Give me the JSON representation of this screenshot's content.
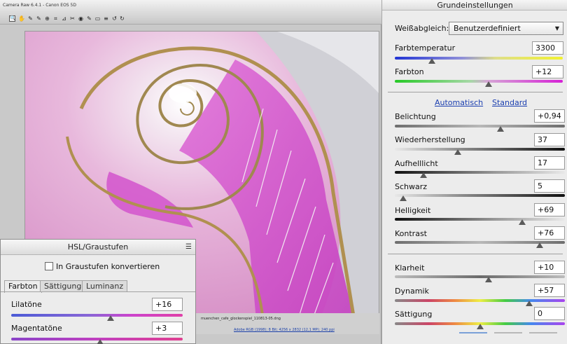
{
  "window": {
    "title": "Camera Raw 6.4.1 - Canon EOS 5D",
    "filename": "muenchen_cafe_glockenspiel_110813-05.dng",
    "workflow_link": "Adobe RGB (1998); 8 Bit; 4256 x 2832 (12,1 MP); 240 ppi"
  },
  "toolbar": {
    "tools": [
      {
        "icon": "zoom-tool-icon",
        "glyph": "🔍"
      },
      {
        "icon": "hand-tool-icon",
        "glyph": "✋"
      },
      {
        "icon": "white-balance-tool-icon",
        "glyph": "✎"
      },
      {
        "icon": "color-sampler-tool-icon",
        "glyph": "✎"
      },
      {
        "icon": "target-adjustment-tool-icon",
        "glyph": "⊕"
      },
      {
        "icon": "crop-tool-icon",
        "glyph": "⌗"
      },
      {
        "icon": "straighten-tool-icon",
        "glyph": "⊿"
      },
      {
        "icon": "spot-removal-tool-icon",
        "glyph": "✂"
      },
      {
        "icon": "red-eye-tool-icon",
        "glyph": "◉"
      },
      {
        "icon": "adjustment-brush-icon",
        "glyph": "✎"
      },
      {
        "icon": "graduated-filter-icon",
        "glyph": "▭"
      },
      {
        "icon": "preferences-icon",
        "glyph": "≡"
      },
      {
        "icon": "rotate-ccw-icon",
        "glyph": "↺"
      },
      {
        "icon": "rotate-cw-icon",
        "glyph": "↻"
      }
    ]
  },
  "settings": {
    "header": "Grundeinstellungen",
    "white_balance_label": "Weißabgleich:",
    "white_balance_value": "Benutzerdefiniert",
    "auto_link": "Automatisch",
    "default_link": "Standard",
    "sliders": [
      {
        "label": "Farbtemperatur",
        "value": "3300",
        "position": 0.22
      },
      {
        "label": "Farbton",
        "value": "+12",
        "position": 0.55
      },
      {
        "label": "Belichtung",
        "value": "+0,94",
        "position": 0.62
      },
      {
        "label": "Wiederherstellung",
        "value": "37",
        "position": 0.37
      },
      {
        "label": "Aufhelllicht",
        "value": "17",
        "position": 0.17
      },
      {
        "label": "Schwarz",
        "value": "5",
        "position": 0.05
      },
      {
        "label": "Helligkeit",
        "value": "+69",
        "position": 0.75
      },
      {
        "label": "Kontrast",
        "value": "+76",
        "position": 0.85
      },
      {
        "label": "Klarheit",
        "value": "+10",
        "position": 0.55
      },
      {
        "label": "Dynamik",
        "value": "+57",
        "position": 0.79
      },
      {
        "label": "Sättigung",
        "value": "0",
        "position": 0.5
      }
    ]
  },
  "hsl": {
    "header": "HSL/Graustufen",
    "grayscale_label": "In Graustufen konvertieren",
    "tabs": [
      "Farbton",
      "Sättigung",
      "Luminanz"
    ],
    "sliders": [
      {
        "label": "Lilatöne",
        "value": "+16",
        "position": 0.58
      },
      {
        "label": "Magentatöne",
        "value": "+3",
        "position": 0.52
      }
    ]
  }
}
